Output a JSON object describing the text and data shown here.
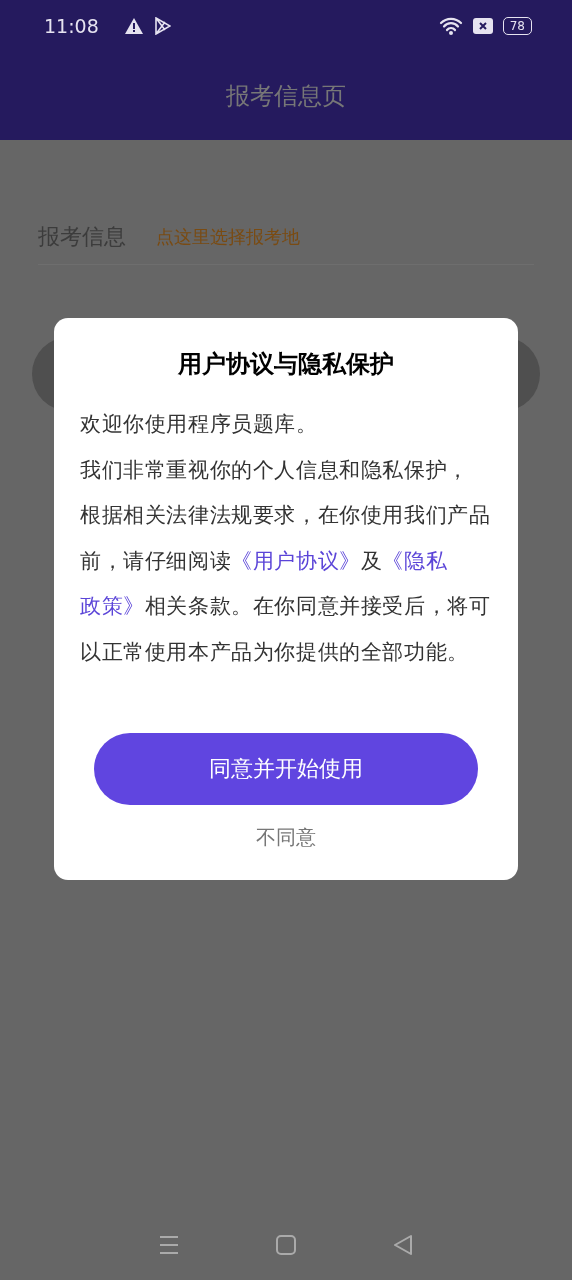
{
  "status_bar": {
    "time": "11:08",
    "battery": "78"
  },
  "header": {
    "title": "报考信息页"
  },
  "exam_info": {
    "label": "报考信息",
    "picker": "点这里选择报考地"
  },
  "dialog": {
    "title": "用户协议与隐私保护",
    "paragraphs": [
      [
        {
          "kind": "text",
          "text": "欢迎你使用程序员题库。"
        }
      ],
      [
        {
          "kind": "text",
          "text": "我们非常重视你的个人信息和隐私保护，"
        }
      ],
      [
        {
          "kind": "text",
          "text": "根据相关法律法规要求，在你使用我们产品前，请仔细阅读"
        },
        {
          "kind": "link",
          "text": "《用户协议》"
        },
        {
          "kind": "text",
          "text": "及"
        },
        {
          "kind": "link",
          "text": "《隐私"
        },
        {
          "kind": "link",
          "text": "政策》"
        },
        {
          "kind": "text",
          "text": "相关条款。在你同意并接受后，将可以正常使用本产品为你提供的全部功能。"
        }
      ]
    ],
    "agree_button": "同意并开始使用",
    "decline_button": "不同意"
  }
}
